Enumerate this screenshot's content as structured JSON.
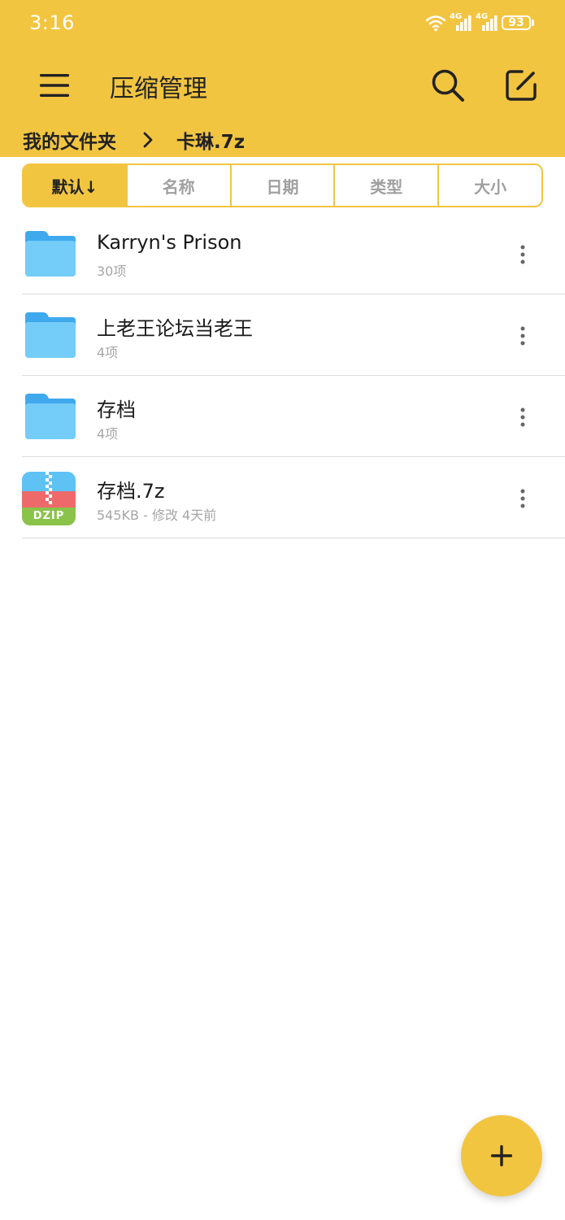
{
  "status_bar": {
    "time": "3:16",
    "network_1": "4G",
    "network_2": "4G",
    "battery": "93"
  },
  "header": {
    "title": "压缩管理",
    "menu_icon": "menu-icon",
    "search_icon": "search-icon",
    "edit_icon": "edit-icon"
  },
  "breadcrumb": {
    "items": [
      {
        "label": "我的文件夹"
      },
      {
        "label": "卡琳.7z"
      }
    ],
    "separator_icon": "chevron-right-icon"
  },
  "sort_tabs": [
    {
      "label": "默认↓",
      "active": true
    },
    {
      "label": "名称",
      "active": false
    },
    {
      "label": "日期",
      "active": false
    },
    {
      "label": "类型",
      "active": false
    },
    {
      "label": "大小",
      "active": false
    }
  ],
  "files": [
    {
      "name": "Karryn's Prison",
      "meta": "30项",
      "type": "folder",
      "icon": "folder-icon"
    },
    {
      "name": "上老王论坛当老王",
      "meta": "4项",
      "type": "folder",
      "icon": "folder-icon"
    },
    {
      "name": "存档",
      "meta": "4项",
      "type": "folder",
      "icon": "folder-icon"
    },
    {
      "name": "存档.7z",
      "meta": "545KB - 修改 4天前",
      "type": "archive",
      "icon": "zip-archive-icon",
      "icon_label": "DZIP"
    }
  ],
  "fab": {
    "icon": "plus-icon"
  },
  "colors": {
    "accent": "#F2C541",
    "folder": "#5EC2F5",
    "folder_tab": "#3FA9EE",
    "zip_top": "#5EC2F5",
    "zip_mid": "#EE6A6A",
    "zip_bottom": "#8BC34A"
  }
}
